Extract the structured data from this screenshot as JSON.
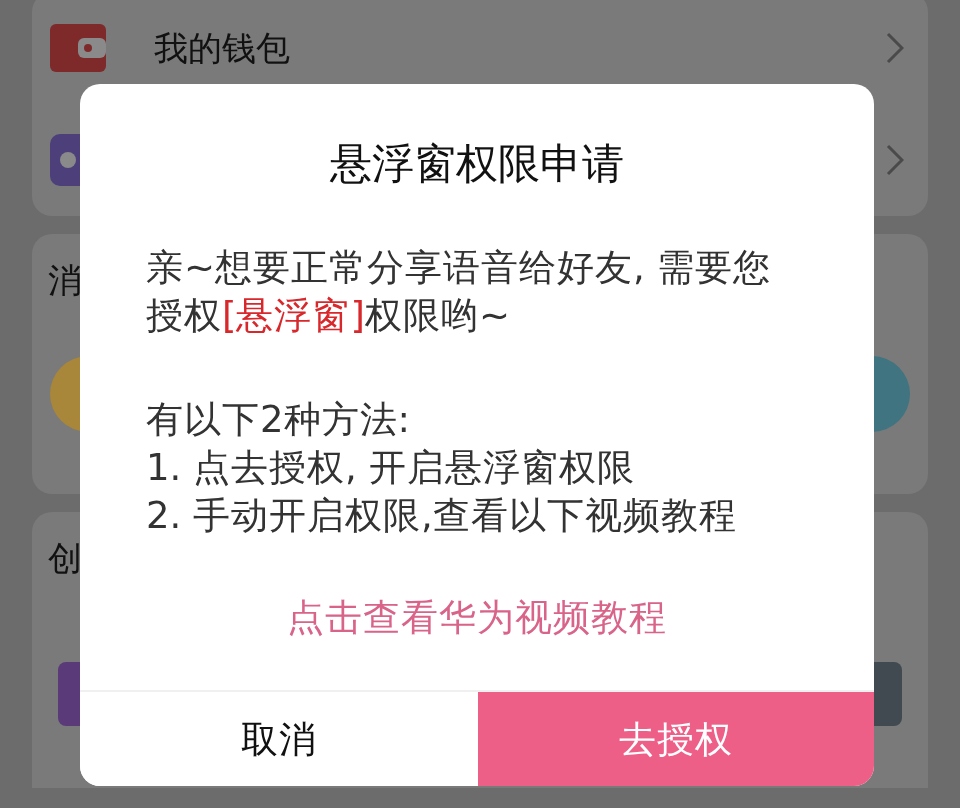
{
  "background": {
    "menu_items": [
      {
        "label": "我的钱包",
        "kind": "wallet"
      },
      {
        "kind": "game"
      }
    ],
    "sections": [
      {
        "title": "消",
        "items": [
          {
            "color": "#a8863a"
          },
          {
            "color": "#3f7480"
          }
        ]
      },
      {
        "title": "创",
        "items": [
          {
            "color": "#5a3a78"
          },
          {
            "color": "#404a50"
          }
        ]
      }
    ]
  },
  "dialog": {
    "title": "悬浮窗权限申请",
    "message": "亲~想要正常分享语音给好友, 需要您授权**[悬浮窗]**权限哟~",
    "methods_heading": "有以下2种方法:",
    "methods": [
      "1. 点去授权, 开启悬浮窗权限",
      "2. 手动开启权限,查看以下视频教程"
    ],
    "link": "点击查看华为视频教程",
    "buttons": [
      {
        "label": "取消",
        "kind": "secondary"
      },
      {
        "label": "去授权",
        "kind": "primary"
      }
    ]
  }
}
